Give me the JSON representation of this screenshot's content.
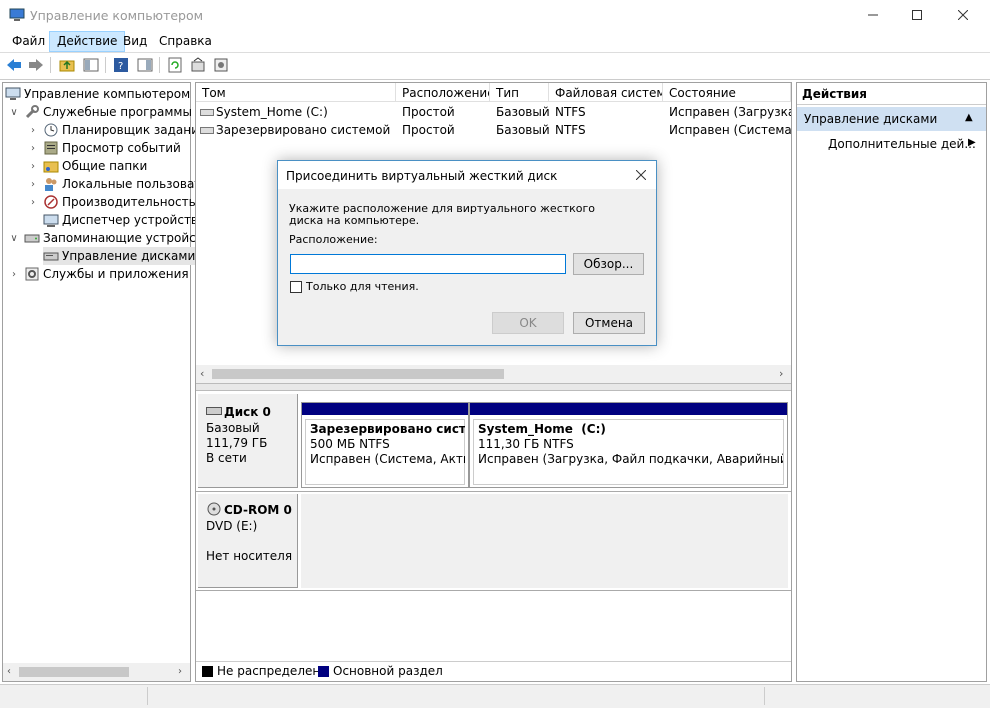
{
  "window": {
    "title": "Управление компьютером"
  },
  "menu": [
    "Файл",
    "Действие",
    "Вид",
    "Справка"
  ],
  "tree": [
    {
      "label": "Управление компьютером (л",
      "level": 0
    },
    {
      "label": "Служебные программы",
      "level": 1
    },
    {
      "label": "Планировщик заданий",
      "level": 2
    },
    {
      "label": "Просмотр событий",
      "level": 2
    },
    {
      "label": "Общие папки",
      "level": 2
    },
    {
      "label": "Локальные пользовате",
      "level": 2
    },
    {
      "label": "Производительность",
      "level": 2
    },
    {
      "label": "Диспетчер устройств",
      "level": 2
    },
    {
      "label": "Запоминающие устройст",
      "level": 1
    },
    {
      "label": "Управление дисками",
      "level": 2
    },
    {
      "label": "Службы и приложения",
      "level": 1
    }
  ],
  "volumes": {
    "columns": [
      "Том",
      "Расположение",
      "Тип",
      "Файловая система",
      "Состояние"
    ],
    "rows": [
      [
        "System_Home (C:)",
        "Простой",
        "Базовый",
        "NTFS",
        "Исправен (Загрузка, Ф"
      ],
      [
        "Зарезервировано системой",
        "Простой",
        "Базовый",
        "NTFS",
        "Исправен (Система, А"
      ]
    ]
  },
  "disks": [
    {
      "name": "Диск 0",
      "type": "Базовый",
      "size": "111,79 ГБ",
      "status": "В сети"
    },
    {
      "name": "CD-ROM 0",
      "type": "DVD (E:)",
      "size": "",
      "status": "Нет носителя"
    }
  ],
  "partitions": [
    {
      "name": "Зарезервировано системо",
      "size": "500 МБ NTFS",
      "status": "Исправен (Система, Активе"
    },
    {
      "name": "System_Home  (C:)",
      "size": "111,30 ГБ NTFS",
      "status": "Исправен (Загрузка, Файл подкачки, Аварийный дамп"
    }
  ],
  "legend": [
    {
      "label": "Не распределена",
      "color": "#000000"
    },
    {
      "label": "Основной раздел",
      "color": "#000080"
    }
  ],
  "actions": {
    "title": "Действия",
    "section": "Управление дисками",
    "more": "Дополнительные дей..."
  },
  "dialog": {
    "title": "Присоединить виртуальный жесткий диск",
    "prompt": "Укажите расположение для виртуального жесткого диска на компьютере.",
    "location_label": "Расположение:",
    "location_value": "",
    "browse": "Обзор...",
    "readonly_label": "Только для чтения.",
    "ok": "OK",
    "cancel": "Отмена"
  }
}
